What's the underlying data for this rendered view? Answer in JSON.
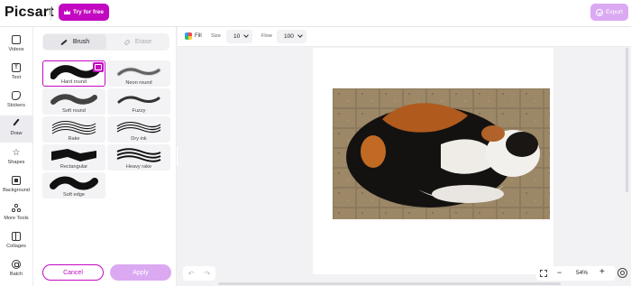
{
  "app": {
    "logo": "Picsart"
  },
  "header": {
    "try_label": "Try for free",
    "export_label": "Export"
  },
  "nav": [
    {
      "label": "Videos",
      "icon": "videos-icon"
    },
    {
      "label": "Text",
      "icon": "text-icon"
    },
    {
      "label": "Stickers",
      "icon": "stickers-icon"
    },
    {
      "label": "Draw",
      "icon": "draw-icon",
      "active": true
    },
    {
      "label": "Shapes",
      "icon": "shapes-icon"
    },
    {
      "label": "Background",
      "icon": "background-icon"
    },
    {
      "label": "More Tools",
      "icon": "more-tools-icon"
    },
    {
      "label": "Collages",
      "icon": "collages-icon"
    },
    {
      "label": "Batch",
      "icon": "batch-icon"
    }
  ],
  "panel": {
    "tab_brush": "Brush",
    "tab_erase": "Erase",
    "brushes": [
      {
        "label": "Hard round",
        "selected": true
      },
      {
        "label": "Neon round"
      },
      {
        "label": "Soft round"
      },
      {
        "label": "Fuzzy"
      },
      {
        "label": "Rake"
      },
      {
        "label": "Dry ink"
      },
      {
        "label": "Rectangular"
      },
      {
        "label": "Heavy rake"
      },
      {
        "label": "Soft edge"
      }
    ],
    "cancel_label": "Cancel",
    "apply_label": "Apply"
  },
  "toolbar": {
    "fill_label": "Fill",
    "size_label": "Size",
    "size_value": "10",
    "flow_label": "Flow",
    "flow_value": "100"
  },
  "zoom": {
    "value": "54%"
  },
  "colors": {
    "accent": "#c209c1",
    "accent_light": "#dba9f2"
  }
}
